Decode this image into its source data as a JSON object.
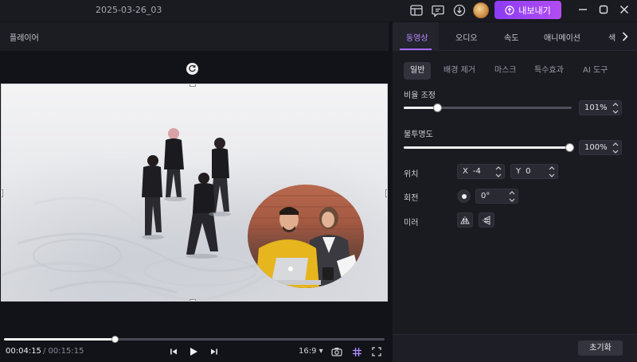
{
  "titlebar": {
    "doc_title": "2025-03-26_03",
    "export_label": "내보내기",
    "accent": "#a040f0"
  },
  "player": {
    "title": "플레이어",
    "time_current": "00:04:15",
    "time_total": "/ 00:15:15",
    "progress": 0.29,
    "aspect_ratio": "16:9 ▾"
  },
  "panel": {
    "tabs": [
      {
        "label": "동영상"
      },
      {
        "label": "오디오"
      },
      {
        "label": "속도"
      },
      {
        "label": "애니메이션"
      },
      {
        "label": "색"
      }
    ],
    "subtabs": [
      {
        "label": "일반"
      },
      {
        "label": "배경 제거"
      },
      {
        "label": "마스크"
      },
      {
        "label": "특수효과"
      },
      {
        "label": "AI 도구"
      }
    ],
    "scale": {
      "label": "비율 조정",
      "value": "101%",
      "level": 0.2
    },
    "opacity": {
      "label": "불투명도",
      "value": "100%",
      "level": 1.0
    },
    "position": {
      "label": "위치",
      "x_label": "X",
      "x_value": "-4",
      "y_label": "Y",
      "y_value": "0"
    },
    "rotation": {
      "label": "회전",
      "value": "0°"
    },
    "mirror": {
      "label": "미러"
    },
    "reset_label": "초기화"
  }
}
